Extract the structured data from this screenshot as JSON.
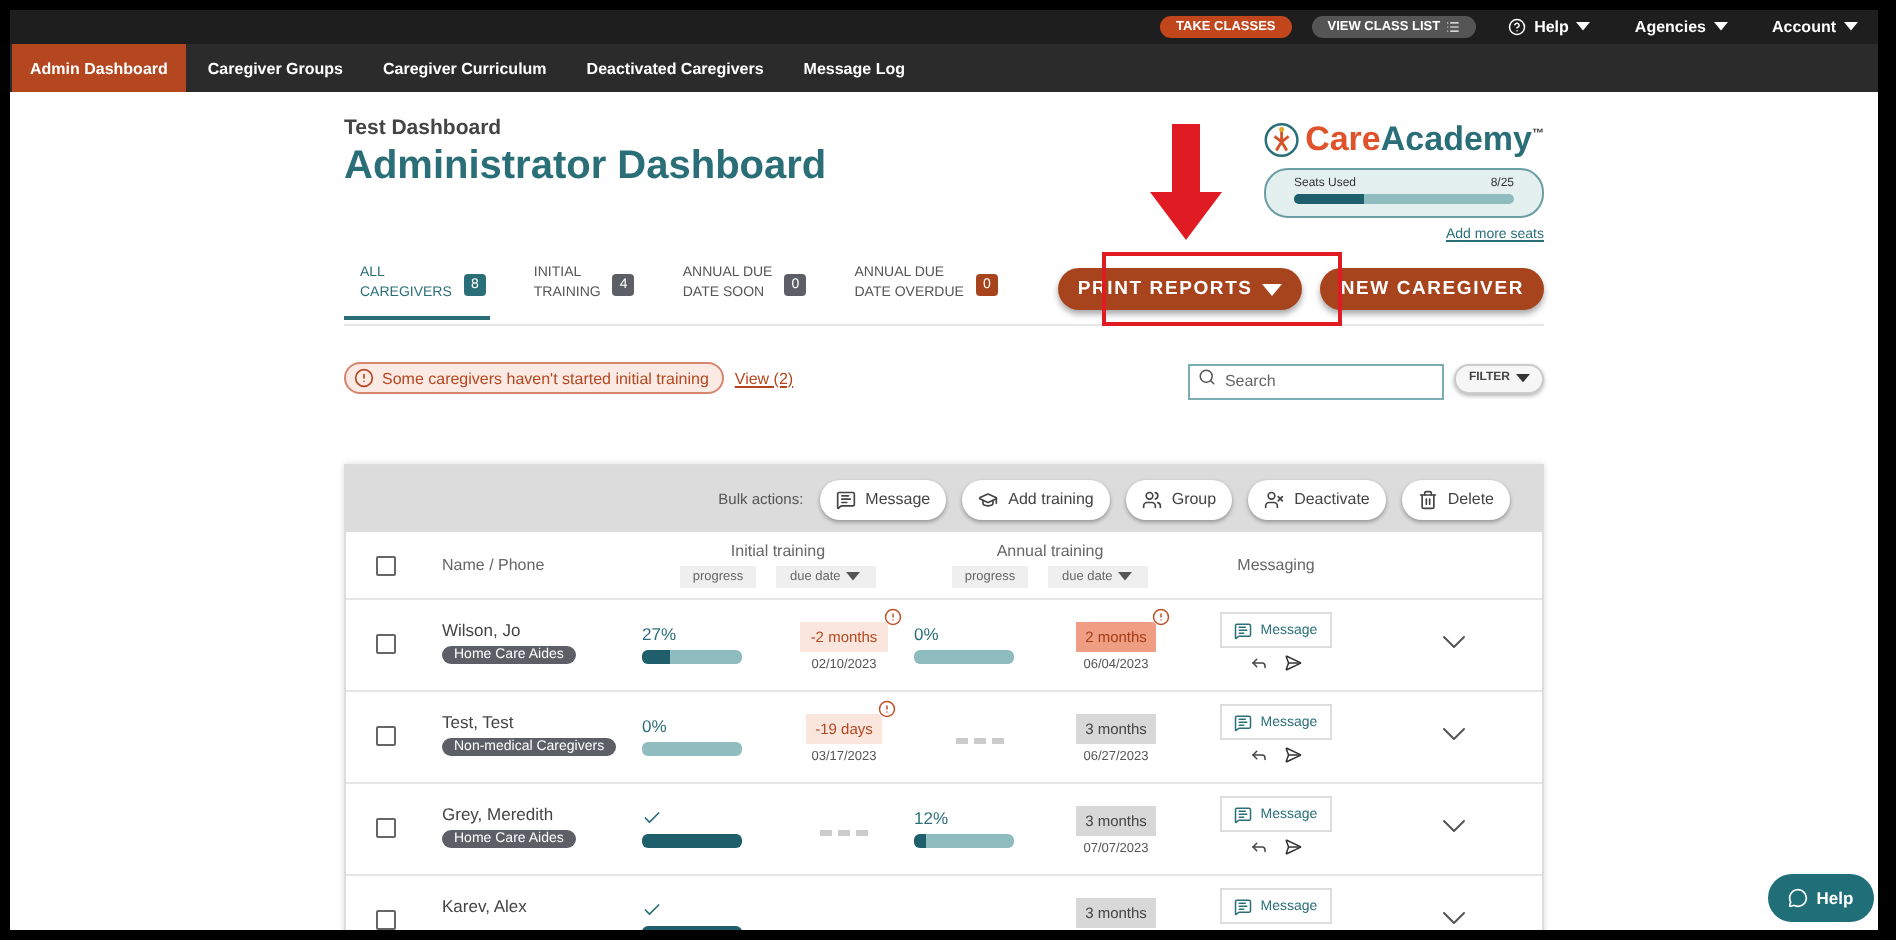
{
  "top_bar": {
    "take_classes": "TAKE CLASSES",
    "view_class_list": "VIEW CLASS LIST",
    "menus": [
      {
        "label": "Help"
      },
      {
        "label": "Agencies"
      },
      {
        "label": "Account"
      }
    ]
  },
  "nav": [
    {
      "label": "Admin Dashboard",
      "selected": true
    },
    {
      "label": "Caregiver Groups",
      "selected": false
    },
    {
      "label": "Caregiver Curriculum",
      "selected": false
    },
    {
      "label": "Deactivated Caregivers",
      "selected": false
    },
    {
      "label": "Message Log",
      "selected": false
    }
  ],
  "header": {
    "subtitle": "Test Dashboard",
    "title": "Administrator Dashboard"
  },
  "logo": {
    "brand": [
      "Care",
      "Academy"
    ],
    "trademark": "™"
  },
  "seats": {
    "label": "Seats Used",
    "reading": "8/25",
    "level": 0.32,
    "link": "Add more seats"
  },
  "tabs": [
    {
      "label_lines": [
        "ALL",
        "CAREGIVERS"
      ],
      "count": "8",
      "color": "#2a6f78",
      "selected": true
    },
    {
      "label_lines": [
        "INITIAL",
        "TRAINING"
      ],
      "count": "4",
      "color": "#5c6066",
      "selected": false
    },
    {
      "label_lines": [
        "ANNUAL DUE",
        "DATE SOON"
      ],
      "count": "0",
      "color": "#5c6066",
      "selected": false
    },
    {
      "label_lines": [
        "ANNUAL DUE",
        "DATE OVERDUE"
      ],
      "count": "0",
      "color": "#a8441d",
      "selected": false
    }
  ],
  "buttons": {
    "print_reports": "PRINT REPORTS",
    "new_caregiver": "NEW CAREGIVER"
  },
  "alert": {
    "text": "Some caregivers haven't started initial training",
    "link": "View (2)"
  },
  "search": {
    "placeholder": "Search"
  },
  "filter": "FILTER",
  "table": {
    "bulk_label": "Bulk actions:",
    "bulk_actions": [
      {
        "label": "Message"
      },
      {
        "label": "Add training"
      },
      {
        "label": "Group"
      },
      {
        "label": "Deactivate"
      },
      {
        "label": "Delete"
      }
    ],
    "select_all_checked": false,
    "columns": {
      "name": "Name / Phone",
      "initial": "Initial training",
      "annual": "Annual training",
      "messaging": "Messaging"
    },
    "subcolumns": [
      {
        "label": "progress",
        "sortable": false
      },
      {
        "label": "due date",
        "sortable": true
      },
      {
        "label": "progress",
        "sortable": false
      },
      {
        "label": "due date",
        "sortable": true
      }
    ],
    "rows": [
      {
        "checked": false,
        "name": "Wilson, Jo",
        "tag": "Home Care Aides",
        "initial": {
          "kind": "progress",
          "text": "27%",
          "level": 0.27
        },
        "initial_due": {
          "kind": "warning",
          "label": "-2 months",
          "alert": true,
          "date": "02/10/2023"
        },
        "annual": {
          "kind": "progress",
          "text": "0%",
          "level": 0
        },
        "annual_due": {
          "kind": "overdue",
          "label": "2 months",
          "alert": true,
          "date": "06/04/2023"
        },
        "message": "Message"
      },
      {
        "checked": false,
        "name": "Test, Test",
        "tag": "Non-medical Caregivers",
        "initial": {
          "kind": "progress",
          "text": "0%",
          "level": 0
        },
        "initial_due": {
          "kind": "warning",
          "label": "-19 days",
          "alert": true,
          "date": "03/17/2023"
        },
        "annual": {
          "kind": "none"
        },
        "annual_due": {
          "kind": "neutral",
          "label": "3 months",
          "alert": false,
          "date": "06/27/2023"
        },
        "message": "Message"
      },
      {
        "checked": false,
        "name": "Grey, Meredith",
        "tag": "Home Care Aides",
        "initial": {
          "kind": "complete"
        },
        "initial_due": {
          "kind": "none"
        },
        "annual": {
          "kind": "progress",
          "text": "12%",
          "level": 0.12
        },
        "annual_due": {
          "kind": "neutral",
          "label": "3 months",
          "alert": false,
          "date": "07/07/2023"
        },
        "message": "Message"
      },
      {
        "checked": false,
        "name": "Karev, Alex",
        "initial": {
          "kind": "complete"
        },
        "annual_due": {
          "kind": "neutral",
          "label": "3 months",
          "alert": false
        },
        "message": "Message"
      }
    ]
  },
  "help_button": "Help"
}
